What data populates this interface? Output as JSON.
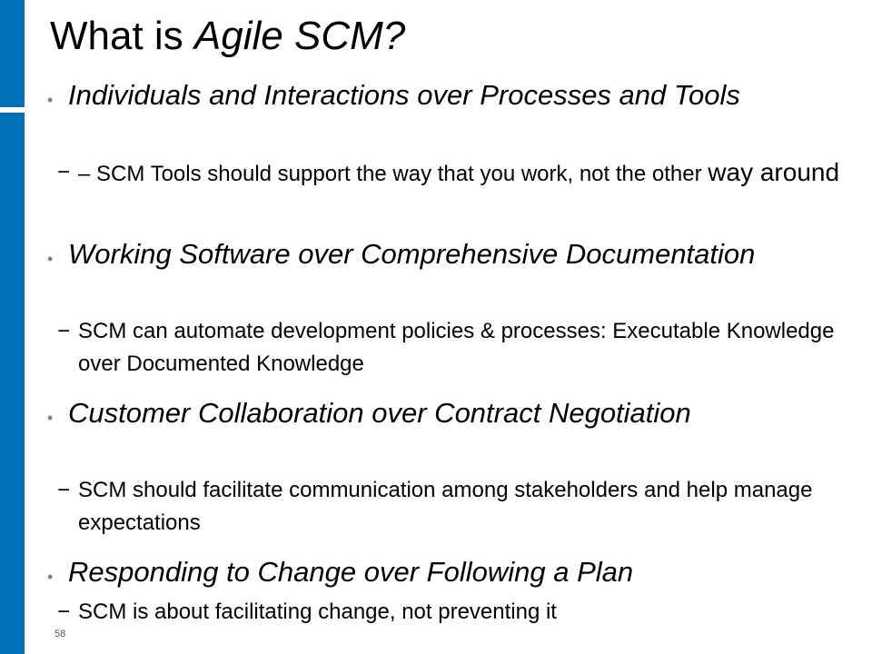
{
  "slide": {
    "title_plain": "What is ",
    "title_italic": "Agile SCM?",
    "page_number": "58",
    "accent_color": "#0070b8",
    "bullet_color": "#808080"
  },
  "bullets": [
    {
      "text": "Individuals and Interactions over Processes and Tools",
      "sub": {
        "dash": "−",
        "text": "– SCM Tools should support the way that you work, not the other ",
        "text_big": "way around"
      }
    },
    {
      "text": "Working Software over Comprehensive Documentation",
      "sub": {
        "dash": "−",
        "text": "SCM can automate development policies & processes: Executable Knowledge over Documented Knowledge"
      }
    },
    {
      "text": "Customer Collaboration over Contract Negotiation",
      "sub": {
        "dash": "−",
        "text": "SCM should facilitate communication among stakeholders and help manage expectations"
      }
    },
    {
      "text": "Responding to Change over Following a Plan",
      "sub": {
        "dash": "−",
        "text": "SCM is about facilitating change, not preventing it"
      }
    }
  ]
}
